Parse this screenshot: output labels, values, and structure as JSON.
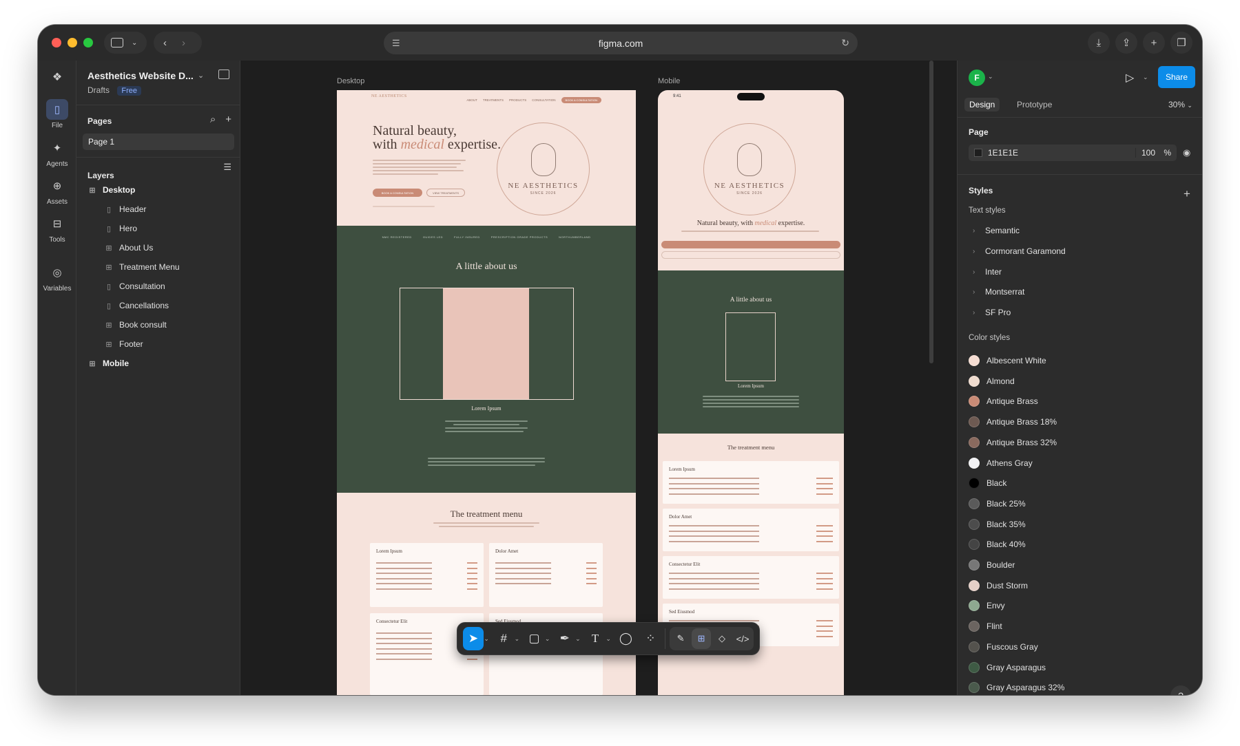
{
  "browser": {
    "url": "figma.com"
  },
  "file": {
    "title": "Aesthetics Website D...",
    "location": "Drafts",
    "plan_badge": "Free"
  },
  "rail": {
    "items": [
      {
        "label": "File",
        "icon": "file-icon"
      },
      {
        "label": "Agents",
        "icon": "sparkle-icon"
      },
      {
        "label": "Assets",
        "icon": "assets-icon"
      },
      {
        "label": "Tools",
        "icon": "toolbox-icon"
      },
      {
        "label": "Variables",
        "icon": "variables-icon"
      }
    ]
  },
  "pages": {
    "title": "Pages",
    "items": [
      "Page 1"
    ]
  },
  "layers": {
    "title": "Layers",
    "items": [
      {
        "label": "Desktop",
        "level": 0
      },
      {
        "label": "Header",
        "level": 1
      },
      {
        "label": "Hero",
        "level": 1
      },
      {
        "label": "About Us",
        "level": 1
      },
      {
        "label": "Treatment Menu",
        "level": 1
      },
      {
        "label": "Consultation",
        "level": 1
      },
      {
        "label": "Cancellations",
        "level": 1
      },
      {
        "label": "Book consult",
        "level": 1
      },
      {
        "label": "Footer",
        "level": 1
      },
      {
        "label": "Mobile",
        "level": 0
      }
    ]
  },
  "canvas": {
    "desktop_label": "Desktop",
    "mobile_label": "Mobile",
    "desktop": {
      "logo": "NE AESTHETICS",
      "nav": [
        "ABOUT",
        "TREATMENTS",
        "PRODUCTS",
        "CONSULTATION"
      ],
      "nav_cta": "BOOK A CONSULTATION",
      "hero_line1": "Natural beauty,",
      "hero_line2_pre": "with ",
      "hero_line2_em": "medical",
      "hero_line2_post": " expertise.",
      "btn_primary": "BOOK A CONSULTATION",
      "btn_secondary": "VIEW TREATMENTS",
      "emblem_name": "NE AESTHETICS",
      "emblem_since": "SINCE 2026",
      "certs": [
        "NMC REGISTERED",
        "GUIDES LED",
        "FULLY INSURED",
        "PRESCRIPTION GRADE PRODUCTS",
        "NORTHUMBERLAND"
      ],
      "about_title": "A little about us",
      "about_name": "Lorem Ipsum",
      "menu_title": "The treatment menu",
      "cards": [
        "Lorem Ipsum",
        "Dolor Amet",
        "Consectetur Elit",
        "Sed Eiusmod"
      ]
    },
    "mobile": {
      "time": "9:41",
      "emblem_name": "NE AESTHETICS",
      "emblem_since": "SINCE 2026",
      "hero_pre": "Natural beauty, with ",
      "hero_em": "medical",
      "hero_post": " expertise.",
      "about_title": "A little about us",
      "about_name": "Lorem Ipsum",
      "menu_title": "The treatment menu",
      "cards": [
        "Lorem Ipsum",
        "Dolor Amet",
        "Consectetur Elit",
        "Sed Eiusmod"
      ]
    }
  },
  "toolbar": {
    "tools": [
      "move-icon",
      "frame-icon",
      "rectangle-icon",
      "pen-icon",
      "text-icon",
      "comment-icon",
      "actions-icon"
    ],
    "modes": [
      "draw-mode-icon",
      "design-mode-icon",
      "dev-component-icon",
      "dev-mode-icon"
    ]
  },
  "right_panel": {
    "avatar_initial": "F",
    "share_label": "Share",
    "tabs": [
      "Design",
      "Prototype"
    ],
    "zoom": "30%",
    "page_section": "Page",
    "page_color_hex": "1E1E1E",
    "page_opacity": "100",
    "page_opacity_unit": "%",
    "styles_title": "Styles",
    "text_styles_title": "Text styles",
    "text_styles": [
      "Semantic",
      "Cormorant Garamond",
      "Inter",
      "Montserrat",
      "SF Pro"
    ],
    "color_styles_title": "Color styles",
    "color_styles": [
      {
        "name": "Albescent White",
        "color": "#f5ddd2"
      },
      {
        "name": "Almond",
        "color": "#f0dccf"
      },
      {
        "name": "Antique Brass",
        "color": "#c98b76"
      },
      {
        "name": "Antique Brass 18%",
        "color": "#6e5a52"
      },
      {
        "name": "Antique Brass 32%",
        "color": "#8a6a5e"
      },
      {
        "name": "Athens Gray",
        "color": "#f2f2f4"
      },
      {
        "name": "Black",
        "color": "#000000"
      },
      {
        "name": "Black 25%",
        "color": "#5a5a5a"
      },
      {
        "name": "Black 35%",
        "color": "#4c4c4c"
      },
      {
        "name": "Black 40%",
        "color": "#444444"
      },
      {
        "name": "Boulder",
        "color": "#777777"
      },
      {
        "name": "Dust Storm",
        "color": "#e5cfc7"
      },
      {
        "name": "Envy",
        "color": "#8ea890"
      },
      {
        "name": "Flint",
        "color": "#6b6460"
      },
      {
        "name": "Fuscous Gray",
        "color": "#54524d"
      },
      {
        "name": "Gray Asparagus",
        "color": "#3e5a44"
      },
      {
        "name": "Gray Asparagus 32%",
        "color": "#4a5a4c"
      }
    ],
    "help": "?"
  }
}
